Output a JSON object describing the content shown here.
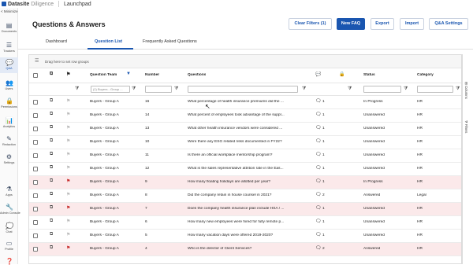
{
  "app": {
    "brand": "Datasite",
    "product": "Diligence",
    "launchpad": "Launchpad",
    "minimize": "< Minimize"
  },
  "sidebar": {
    "items": [
      {
        "label": "Documents",
        "icon": "document-icon",
        "glyph": "▤"
      },
      {
        "label": "Trackers",
        "icon": "tracker-icon",
        "glyph": "☰"
      },
      {
        "label": "Q&A",
        "icon": "qa-icon",
        "glyph": "💬",
        "active": true
      },
      {
        "label": "Users",
        "icon": "users-icon",
        "glyph": "👥"
      },
      {
        "label": "Permissions",
        "icon": "lock-icon",
        "glyph": "🔒"
      },
      {
        "label": "Analytics",
        "icon": "analytics-icon",
        "glyph": "📊"
      },
      {
        "label": "Redaction",
        "icon": "redaction-icon",
        "glyph": "✎"
      },
      {
        "label": "Settings",
        "icon": "gear-icon",
        "glyph": "⚙"
      },
      {
        "label": "Apps",
        "icon": "apps-icon",
        "glyph": "⚗"
      },
      {
        "label": "Admin Console",
        "icon": "admin-icon",
        "glyph": "🔧"
      },
      {
        "label": "Chat",
        "icon": "chat-icon",
        "glyph": "💭"
      },
      {
        "label": "Profile",
        "icon": "profile-icon",
        "glyph": "▭"
      },
      {
        "label": "",
        "icon": "help-icon",
        "glyph": "❓"
      }
    ]
  },
  "header": {
    "title": "Questions & Answers",
    "buttons": {
      "clear_filters": "Clear Filters (1)",
      "new_faq": "New FAQ",
      "export": "Export",
      "import": "Import",
      "qa_settings": "Q&A Settings"
    }
  },
  "tabs": [
    "Dashboard",
    "Question List",
    "Frequently Asked Questions"
  ],
  "grid": {
    "group_hint": "Drag here to set row groups",
    "columns": {
      "question_team": "Question Team",
      "number": "Number",
      "questions": "Questions",
      "status": "Status",
      "category": "Category"
    },
    "filter_team_value": "(1) Buyers - Group ...",
    "rows": [
      {
        "team": "Buyers - Group A",
        "number": "16",
        "question": "What percentage of health insurance premiums did the ...",
        "comments": "1",
        "status": "In Progress",
        "category": "HR",
        "flagged": false
      },
      {
        "team": "Buyers - Group A",
        "number": "14",
        "question": "What percent of employees took advantage of the suppl...",
        "comments": "1",
        "status": "Unanswered",
        "category": "HR",
        "flagged": false
      },
      {
        "team": "Buyers - Group A",
        "number": "13",
        "question": "What other health insurance vendors were considered ...",
        "comments": "1",
        "status": "Unanswered",
        "category": "HR",
        "flagged": false
      },
      {
        "team": "Buyers - Group A",
        "number": "10",
        "question": "Were there any ESG related risks documented in FY22?",
        "comments": "1",
        "status": "Unanswered",
        "category": "HR",
        "flagged": false
      },
      {
        "team": "Buyers - Group A",
        "number": "11",
        "question": "Is there an official workplace mentorship program?",
        "comments": "1",
        "status": "Unanswered",
        "category": "HR",
        "flagged": false
      },
      {
        "team": "Buyers - Group A",
        "number": "12",
        "question": "What is the sales representative attrition rate in the Eas...",
        "comments": "1",
        "status": "Unanswered",
        "category": "HR",
        "flagged": false
      },
      {
        "team": "Buyers - Group A",
        "number": "9",
        "question": "How many floating holidays are allotted per year?",
        "comments": "1",
        "status": "In Progress",
        "category": "HR",
        "flagged": true
      },
      {
        "team": "Buyers - Group A",
        "number": "8",
        "question": "Did the company retain in house counsel in 2021?",
        "comments": "2",
        "status": "Answered",
        "category": "Legal",
        "flagged": false
      },
      {
        "team": "Buyers - Group A",
        "number": "7",
        "question": "Does the company health insurance plan include HSA / ...",
        "comments": "1",
        "status": "Unanswered",
        "category": "HR",
        "flagged": true
      },
      {
        "team": "Buyers - Group A",
        "number": "6",
        "question": "How many new employees were hired for fully remote p...",
        "comments": "1",
        "status": "Unanswered",
        "category": "HR",
        "flagged": false
      },
      {
        "team": "Buyers - Group A",
        "number": "5",
        "question": "How many vacation days were offered 2019-2020?",
        "comments": "1",
        "status": "Unanswered",
        "category": "HR",
        "flagged": false
      },
      {
        "team": "Buyers - Group A",
        "number": "4",
        "question": "Who is the director of Client Services?",
        "comments": "2",
        "status": "Answered",
        "category": "HR",
        "flagged": true
      }
    ]
  },
  "rightbar": {
    "columns": "Columns",
    "filters": "Filters"
  },
  "colors": {
    "accent": "#1a56b0",
    "flag": "#c62828",
    "flagged_row": "#fbe9ea"
  }
}
